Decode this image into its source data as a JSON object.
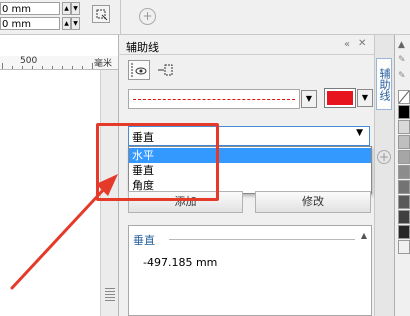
{
  "toolbar": {
    "field1_value": "0 mm",
    "field2_value": "0 mm"
  },
  "ruler": {
    "mark_500": "500",
    "unit": "毫米"
  },
  "docker": {
    "title": "辅助线",
    "tab_label": "辅助线",
    "line_color": "#e8141d",
    "guide_type": {
      "value": "垂直",
      "options": [
        "水平",
        "垂直",
        "角度"
      ],
      "highlighted": "水平"
    },
    "add_label": "添加",
    "modify_label": "修改",
    "list": {
      "header": "垂直",
      "value": "-497.185 mm"
    }
  },
  "palette_colors": [
    "#ffffff",
    "#000000",
    "#d9d9d9",
    "#bfbfbf",
    "#a6a6a6",
    "#8c8c8c",
    "#737373",
    "#595959",
    "#404040",
    "#262626"
  ]
}
